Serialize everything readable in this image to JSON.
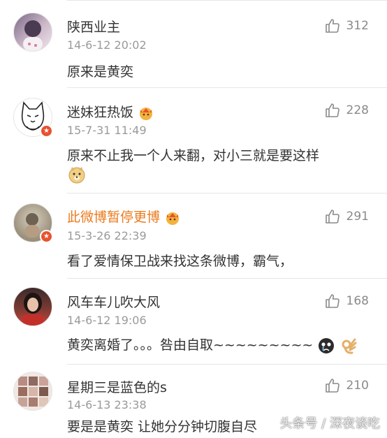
{
  "comments": [
    {
      "name": "陕西业主",
      "time": "14-6-12 20:02",
      "likes": "312",
      "text": "原来是黄奕",
      "avatar": "avatar-girl-icon"
    },
    {
      "name": "迷妹狂热饭",
      "time": "15-7-31 11:49",
      "likes": "228",
      "text": "原来不止我一个人来翻，对小三就是要这样",
      "avatar": "white-cat-icon"
    },
    {
      "name": "此微博暂停更博",
      "time": "15-3-26 22:39",
      "likes": "291",
      "text": "看了爱情保卫战来找这条微博，霸气，",
      "avatar": "avatar-blur-icon"
    },
    {
      "name": "风车车儿吹大风",
      "time": "14-6-12 19:06",
      "likes": "168",
      "text": "黄奕离婚了。。。咎由自取~~~~~~~~~",
      "avatar": "avatar-woman-icon"
    },
    {
      "name": "星期三是蓝色的s",
      "time": "14-6-13 23:38",
      "likes": "210",
      "text": "要是是黄奕 让她分分钟切腹自尽",
      "avatar": "avatar-collage-icon"
    }
  ],
  "watermark": "头条号 / 深夜谈吃",
  "colors": {
    "orange_name": "#eb7a1c",
    "verified_badge": "#e8522f",
    "meta_gray": "#9a9a9a"
  }
}
